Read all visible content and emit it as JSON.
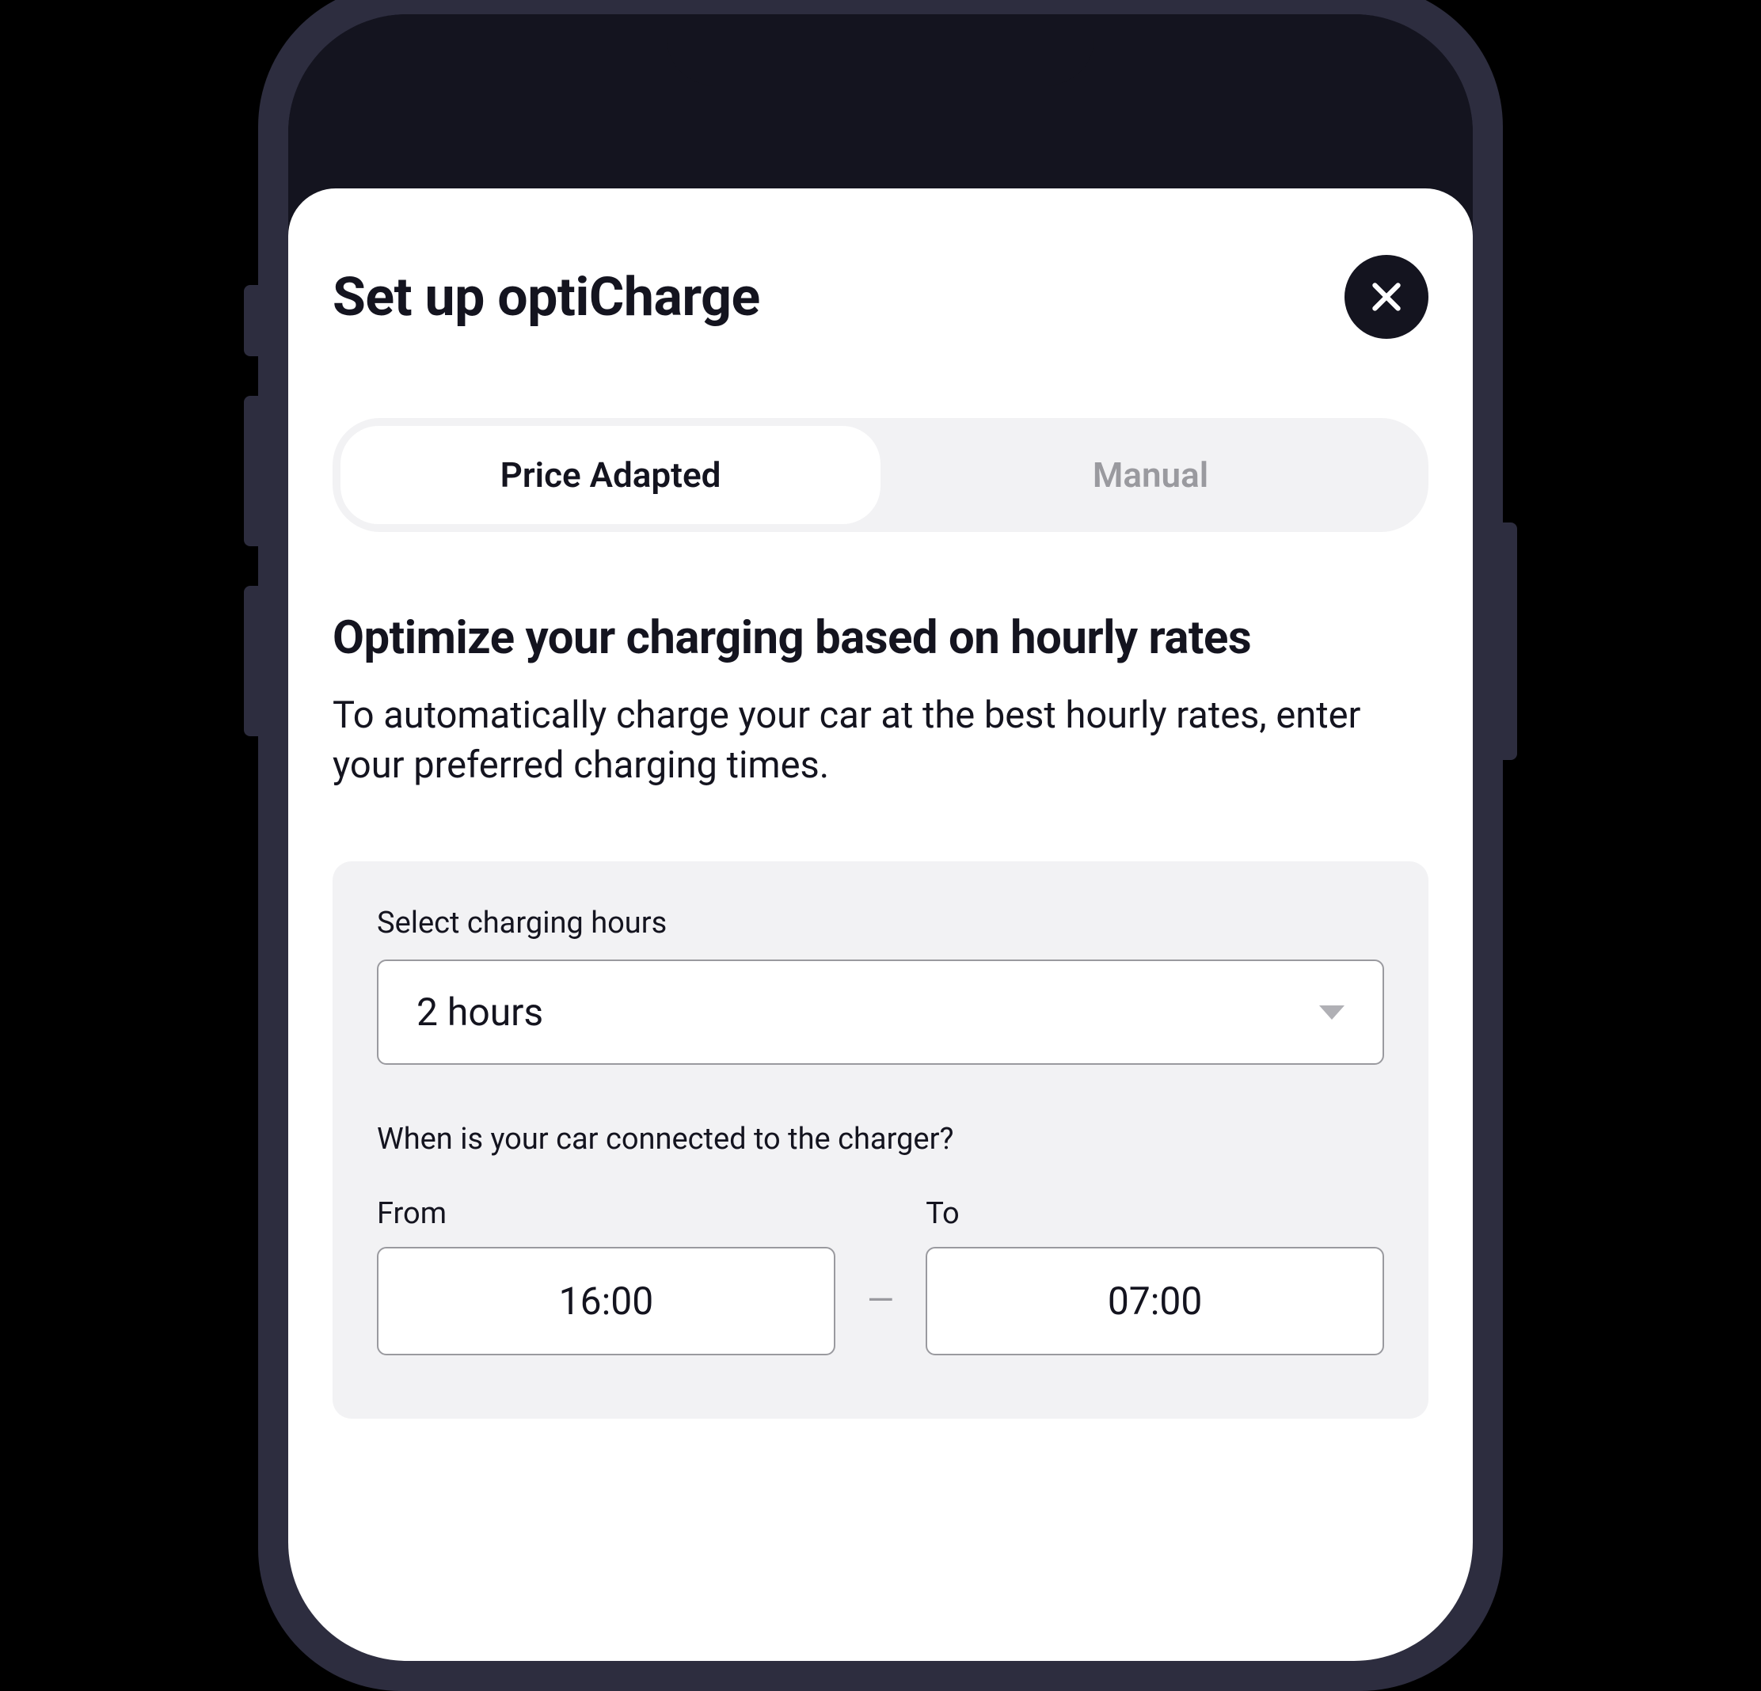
{
  "modal": {
    "title": "Set up optiCharge"
  },
  "tabs": {
    "price_adapted": "Price Adapted",
    "manual": "Manual"
  },
  "section": {
    "title": "Optimize your charging based on hourly rates",
    "description": "To automatically charge your car at the best hourly rates, enter your preferred charging times."
  },
  "form": {
    "hours_label": "Select charging hours",
    "hours_value": "2 hours",
    "connection_question": "When is your car connected to the charger?",
    "from_label": "From",
    "from_value": "16:00",
    "to_label": "To",
    "to_value": "07:00",
    "separator": "—"
  }
}
